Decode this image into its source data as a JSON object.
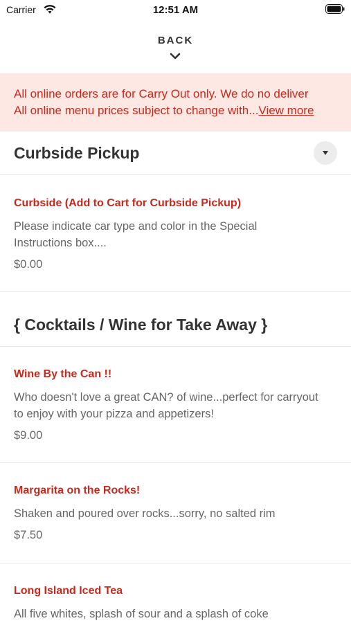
{
  "status_bar": {
    "carrier": "Carrier",
    "time": "12:51 AM"
  },
  "nav": {
    "back_label": "BACK"
  },
  "notice": {
    "line1": "All online orders are for Carry Out only. We do no deliver",
    "line2": "All online menu prices subject to change with...",
    "view_more": "View more"
  },
  "sections": [
    {
      "title": "Curbside Pickup",
      "items": [
        {
          "name": "Curbside (Add to Cart for Curbside Pickup)",
          "description": "Please indicate car type and color in the Special Instructions box....",
          "price": "$0.00"
        }
      ]
    },
    {
      "title": "{ Cocktails / Wine for Take Away }",
      "items": [
        {
          "name": "Wine By the Can !!",
          "description": "Who doesn't love a great CAN? of wine...perfect for carryout to enjoy with your pizza and appetizers!",
          "price": "$9.00"
        },
        {
          "name": "Margarita on the Rocks!",
          "description": "Shaken and poured over rocks...sorry, no salted rim",
          "price": "$7.50"
        },
        {
          "name": "Long Island Iced Tea",
          "description": "All five whites, splash of sour and a splash of coke",
          "price": ""
        }
      ]
    }
  ],
  "colors": {
    "accent": "#c8291c",
    "notice_bg": "#fde8e4",
    "divider": "#e6e6e6"
  }
}
